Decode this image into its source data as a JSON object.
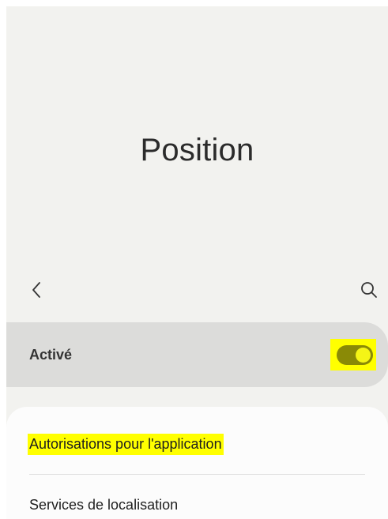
{
  "header": {
    "title": "Position"
  },
  "toolbar": {
    "back_icon": "chevron-left-icon",
    "search_icon": "search-icon"
  },
  "master_switch": {
    "label": "Activé",
    "state": "on",
    "highlighted": true
  },
  "settings_list": {
    "items": [
      {
        "label": "Autorisations pour l'application",
        "highlighted": true
      },
      {
        "label": "Services de localisation",
        "highlighted": false
      }
    ]
  },
  "colors": {
    "background": "#f2f2ef",
    "master_row": "#dcdcda",
    "card": "#fcfcfc",
    "highlight": "#ffff00",
    "toggle_track": "#8a8a06",
    "toggle_knob": "#f5f516"
  }
}
